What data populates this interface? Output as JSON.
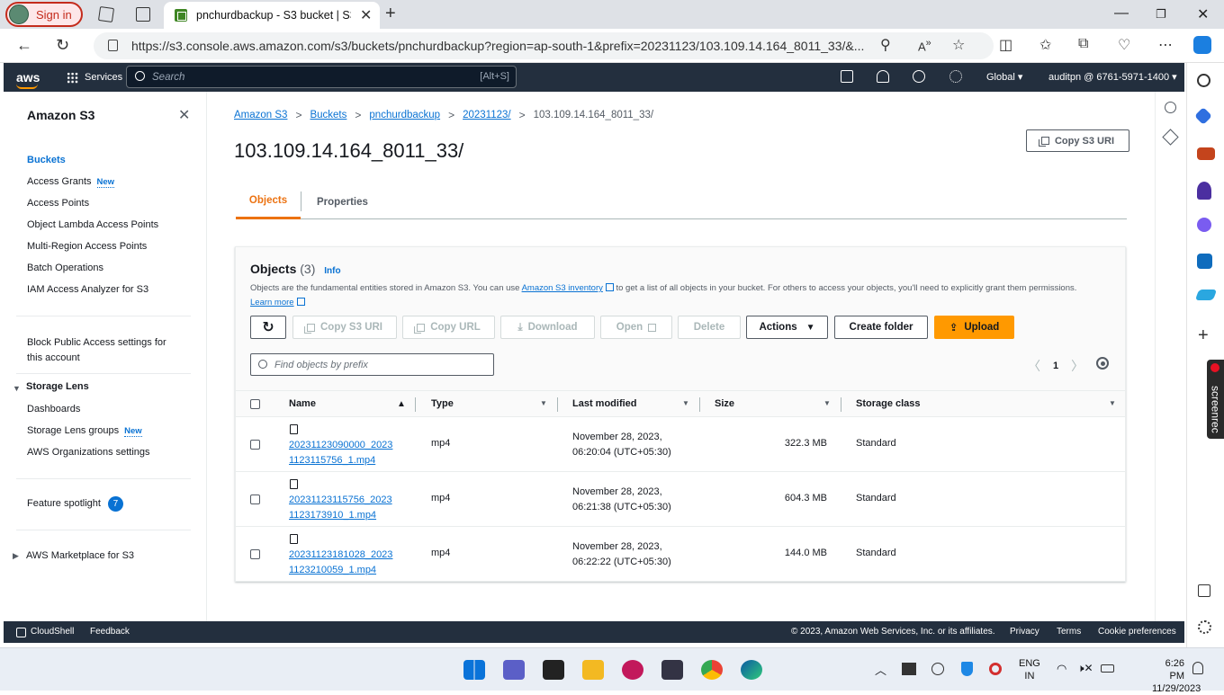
{
  "browser": {
    "signin_label": "Sign in",
    "tab_title": "pnchurdbackup - S3 bucket | S3",
    "url": "https://s3.console.aws.amazon.com/s3/buckets/pnchurdbackup?region=ap-south-1&prefix=20231123/103.109.14.164_8011_33/&..."
  },
  "aws_nav": {
    "logo": "aws",
    "services_label": "Services",
    "search_placeholder": "Search",
    "search_hint": "[Alt+S]",
    "region_label": "Global",
    "account_label": "auditpn @ 6761-5971-1400"
  },
  "sidebar": {
    "title": "Amazon S3",
    "items": [
      {
        "label": "Buckets"
      },
      {
        "label": "Access Grants",
        "badge": "New"
      },
      {
        "label": "Access Points"
      },
      {
        "label": "Object Lambda Access Points"
      },
      {
        "label": "Multi-Region Access Points"
      },
      {
        "label": "Batch Operations"
      },
      {
        "label": "IAM Access Analyzer for S3"
      }
    ],
    "block_public_line1": "Block Public Access settings for",
    "block_public_line2": "this account",
    "storage_lens": {
      "header": "Storage Lens",
      "items": [
        {
          "label": "Dashboards"
        },
        {
          "label": "Storage Lens groups",
          "badge": "New"
        },
        {
          "label": "AWS Organizations settings"
        }
      ]
    },
    "feature_spotlight": {
      "label": "Feature spotlight",
      "count": "7"
    },
    "marketplace": "AWS Marketplace for S3"
  },
  "breadcrumb": {
    "items": [
      "Amazon S3",
      "Buckets",
      "pnchurdbackup",
      "20231123/"
    ],
    "current": "103.109.14.164_8011_33/"
  },
  "page": {
    "title": "103.109.14.164_8011_33/",
    "copy_s3_uri": "Copy S3 URI",
    "tabs": [
      "Objects",
      "Properties"
    ]
  },
  "objects_panel": {
    "title": "Objects",
    "count": "(3)",
    "info": "Info",
    "desc_before": "Objects are the fundamental entities stored in Amazon S3. You can use ",
    "desc_link": "Amazon S3 inventory",
    "desc_after": " to get a list of all objects in your bucket. For others to access your objects, you'll need to explicitly grant them permissions.",
    "learn_more": "Learn more",
    "buttons": {
      "copy_s3_uri": "Copy S3 URI",
      "copy_url": "Copy URL",
      "download": "Download",
      "open": "Open",
      "delete": "Delete",
      "actions": "Actions",
      "create_folder": "Create folder",
      "upload": "Upload"
    },
    "filter_placeholder": "Find objects by prefix",
    "page_number": "1",
    "columns": [
      "Name",
      "Type",
      "Last modified",
      "Size",
      "Storage class"
    ],
    "rows": [
      {
        "name1": "20231123090000_2023",
        "name2": "1123115756_1.mp4",
        "type": "mp4",
        "mod1": "November 28, 2023,",
        "mod2": "06:20:04 (UTC+05:30)",
        "size": "322.3 MB",
        "storage": "Standard"
      },
      {
        "name1": "20231123115756_2023",
        "name2": "1123173910_1.mp4",
        "type": "mp4",
        "mod1": "November 28, 2023,",
        "mod2": "06:21:38 (UTC+05:30)",
        "size": "604.3 MB",
        "storage": "Standard"
      },
      {
        "name1": "20231123181028_2023",
        "name2": "1123210059_1.mp4",
        "type": "mp4",
        "mod1": "November 28, 2023,",
        "mod2": "06:22:22 (UTC+05:30)",
        "size": "144.0 MB",
        "storage": "Standard"
      }
    ]
  },
  "footer": {
    "cloudshell": "CloudShell",
    "feedback": "Feedback",
    "copyright": "© 2023, Amazon Web Services, Inc. or its affiliates.",
    "privacy": "Privacy",
    "terms": "Terms",
    "cookies": "Cookie preferences"
  },
  "screenrec": "screenrec",
  "taskbar": {
    "lang1": "ENG",
    "lang2": "IN",
    "time": "6:26 PM",
    "date": "11/29/2023"
  },
  "colors": {
    "aws_nav": "#232f3e",
    "accent": "#ec7211",
    "upload": "#ff9900",
    "link": "#0972d3"
  }
}
